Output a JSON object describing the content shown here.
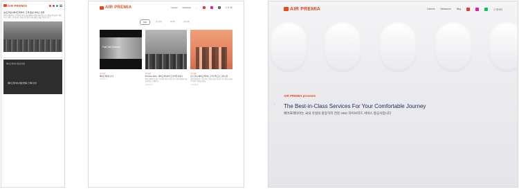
{
  "mobile": {
    "brand": "AIR PREMIA",
    "title": "[보도자료] 에어프레미아, 고객 중심 서비스 강화",
    "description": "에어프레미아가 고객 중심 서비스를 강화하기 위한 새로운 프로그램을 선보였다. 이번 프로그램은 고객 만족도 향상과 안전한 여행 환경 조성을 목표로 한다.",
    "video_title": "에어프레미아 채용설명회",
    "video_subtitle": "[에어프레미아] 채용설명회 스케치 영상"
  },
  "news": {
    "brand": "AIR PREMIA",
    "nav": [
      "Careers",
      "Newsroom"
    ],
    "lang": "한국어",
    "tabs": [
      "전체",
      "보도자료",
      "미디어",
      "공지사항"
    ],
    "cards": [
      {
        "image_caption": "Fast Talk Essence",
        "category": "보도자료",
        "title": "에어프레미아 소식",
        "description": "",
        "date": "2023.10.12"
      },
      {
        "category": "보도자료",
        "title": "Premium Story : 에어프레미아의 프리미엄 이야기",
        "description": "에어프레미아가 전한 프리미엄 서비스 이야기와 고객과 함께한 특별한 여정을 소개합니다.",
        "date": "2023.10.05"
      },
      {
        "category": "보도자료",
        "title": "[보도자료] 에어프레미아, 고객 만족 프로그램 시행",
        "description": "에어프레미아가 고객 만족도 향상을 위한 새로운 프로그램을 시행하며 서비스 품질을 높인다.",
        "date": "2023.09.28"
      }
    ]
  },
  "landing": {
    "brand": "AIR PREMIA",
    "nav": [
      "Careers",
      "Newsroom",
      "Blog"
    ],
    "lang": "한국어",
    "presents": "AIR PREMIA presents",
    "headline": "The Best-in-Class Services For Your Comfortable Journey",
    "subtitle": "에어프레미아는 국내 유일의 중장거리 전문 HSC 하이브리드 서비스 항공사입니다"
  },
  "colors": {
    "brand": "#e64a19",
    "navy": "#1a2a4a",
    "youtube": "#e53935",
    "instagram": "#d6249f",
    "naver": "#03c75a"
  }
}
